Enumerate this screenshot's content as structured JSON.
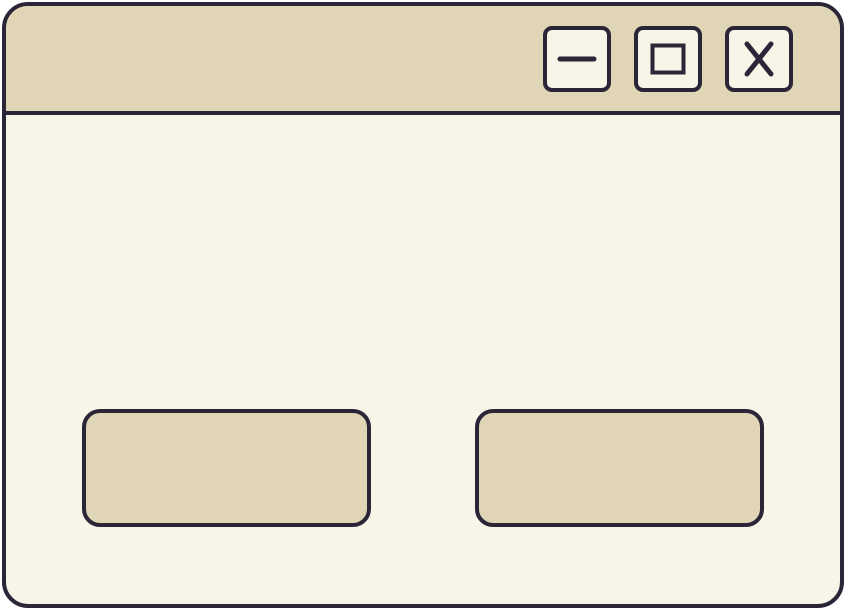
{
  "window": {
    "title": "",
    "controls": {
      "minimize_icon": "minimize-icon",
      "maximize_icon": "maximize-icon",
      "close_icon": "close-icon"
    }
  },
  "actions": {
    "primary_label": "",
    "secondary_label": ""
  },
  "colors": {
    "outline": "#2a2638",
    "titlebar": "#e0d5b5",
    "body": "#f7f4e8",
    "button_fill": "#e0d5b5"
  }
}
